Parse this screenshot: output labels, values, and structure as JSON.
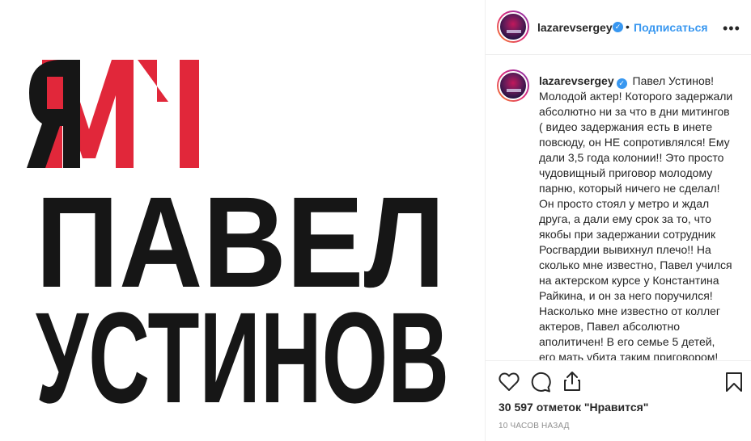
{
  "media": {
    "poster_word_top": "ЯМЫ",
    "poster_line_1": "ПАВЕЛ",
    "poster_line_2": "УСТИНОВ",
    "accent_red": "#e1273a",
    "text_dark": "#161616"
  },
  "header": {
    "username": "lazarevsergey",
    "verified_icon": "verified-badge-icon",
    "separator": "•",
    "follow_label": "Подписаться",
    "more_label": "•••"
  },
  "caption": {
    "username": "lazarevsergey",
    "text": "Павел Устинов! Молодой актер! Которого задержали абсолютно ни за что в дни митингов ( видео задержания есть в инете повсюду, он НЕ сопротивлялся! Ему дали 3,5 года колонии!! Это просто чудовищный приговор молодому парню, который ничего не сделал! Он просто стоял у метро и ждал друга, а дали ему срок за то, что якобы при задержании сотрудник Росгвардии вывихнул плечо!! На сколько мне известно, Павел учился на актерском курсе у Константина Райкина, и он за него поручился! Насколько мне известно от коллег актеров, Павел абсолютно аполитичен! В его семье 5 детей, его мать убита таким приговором! Что"
  },
  "actions": {
    "like_icon": "heart-icon",
    "comment_icon": "comment-icon",
    "share_icon": "share-icon",
    "save_icon": "bookmark-icon",
    "likes_text": "30 597 отметок \"Нравится\"",
    "timestamp": "10 ЧАСОВ НАЗАД"
  }
}
